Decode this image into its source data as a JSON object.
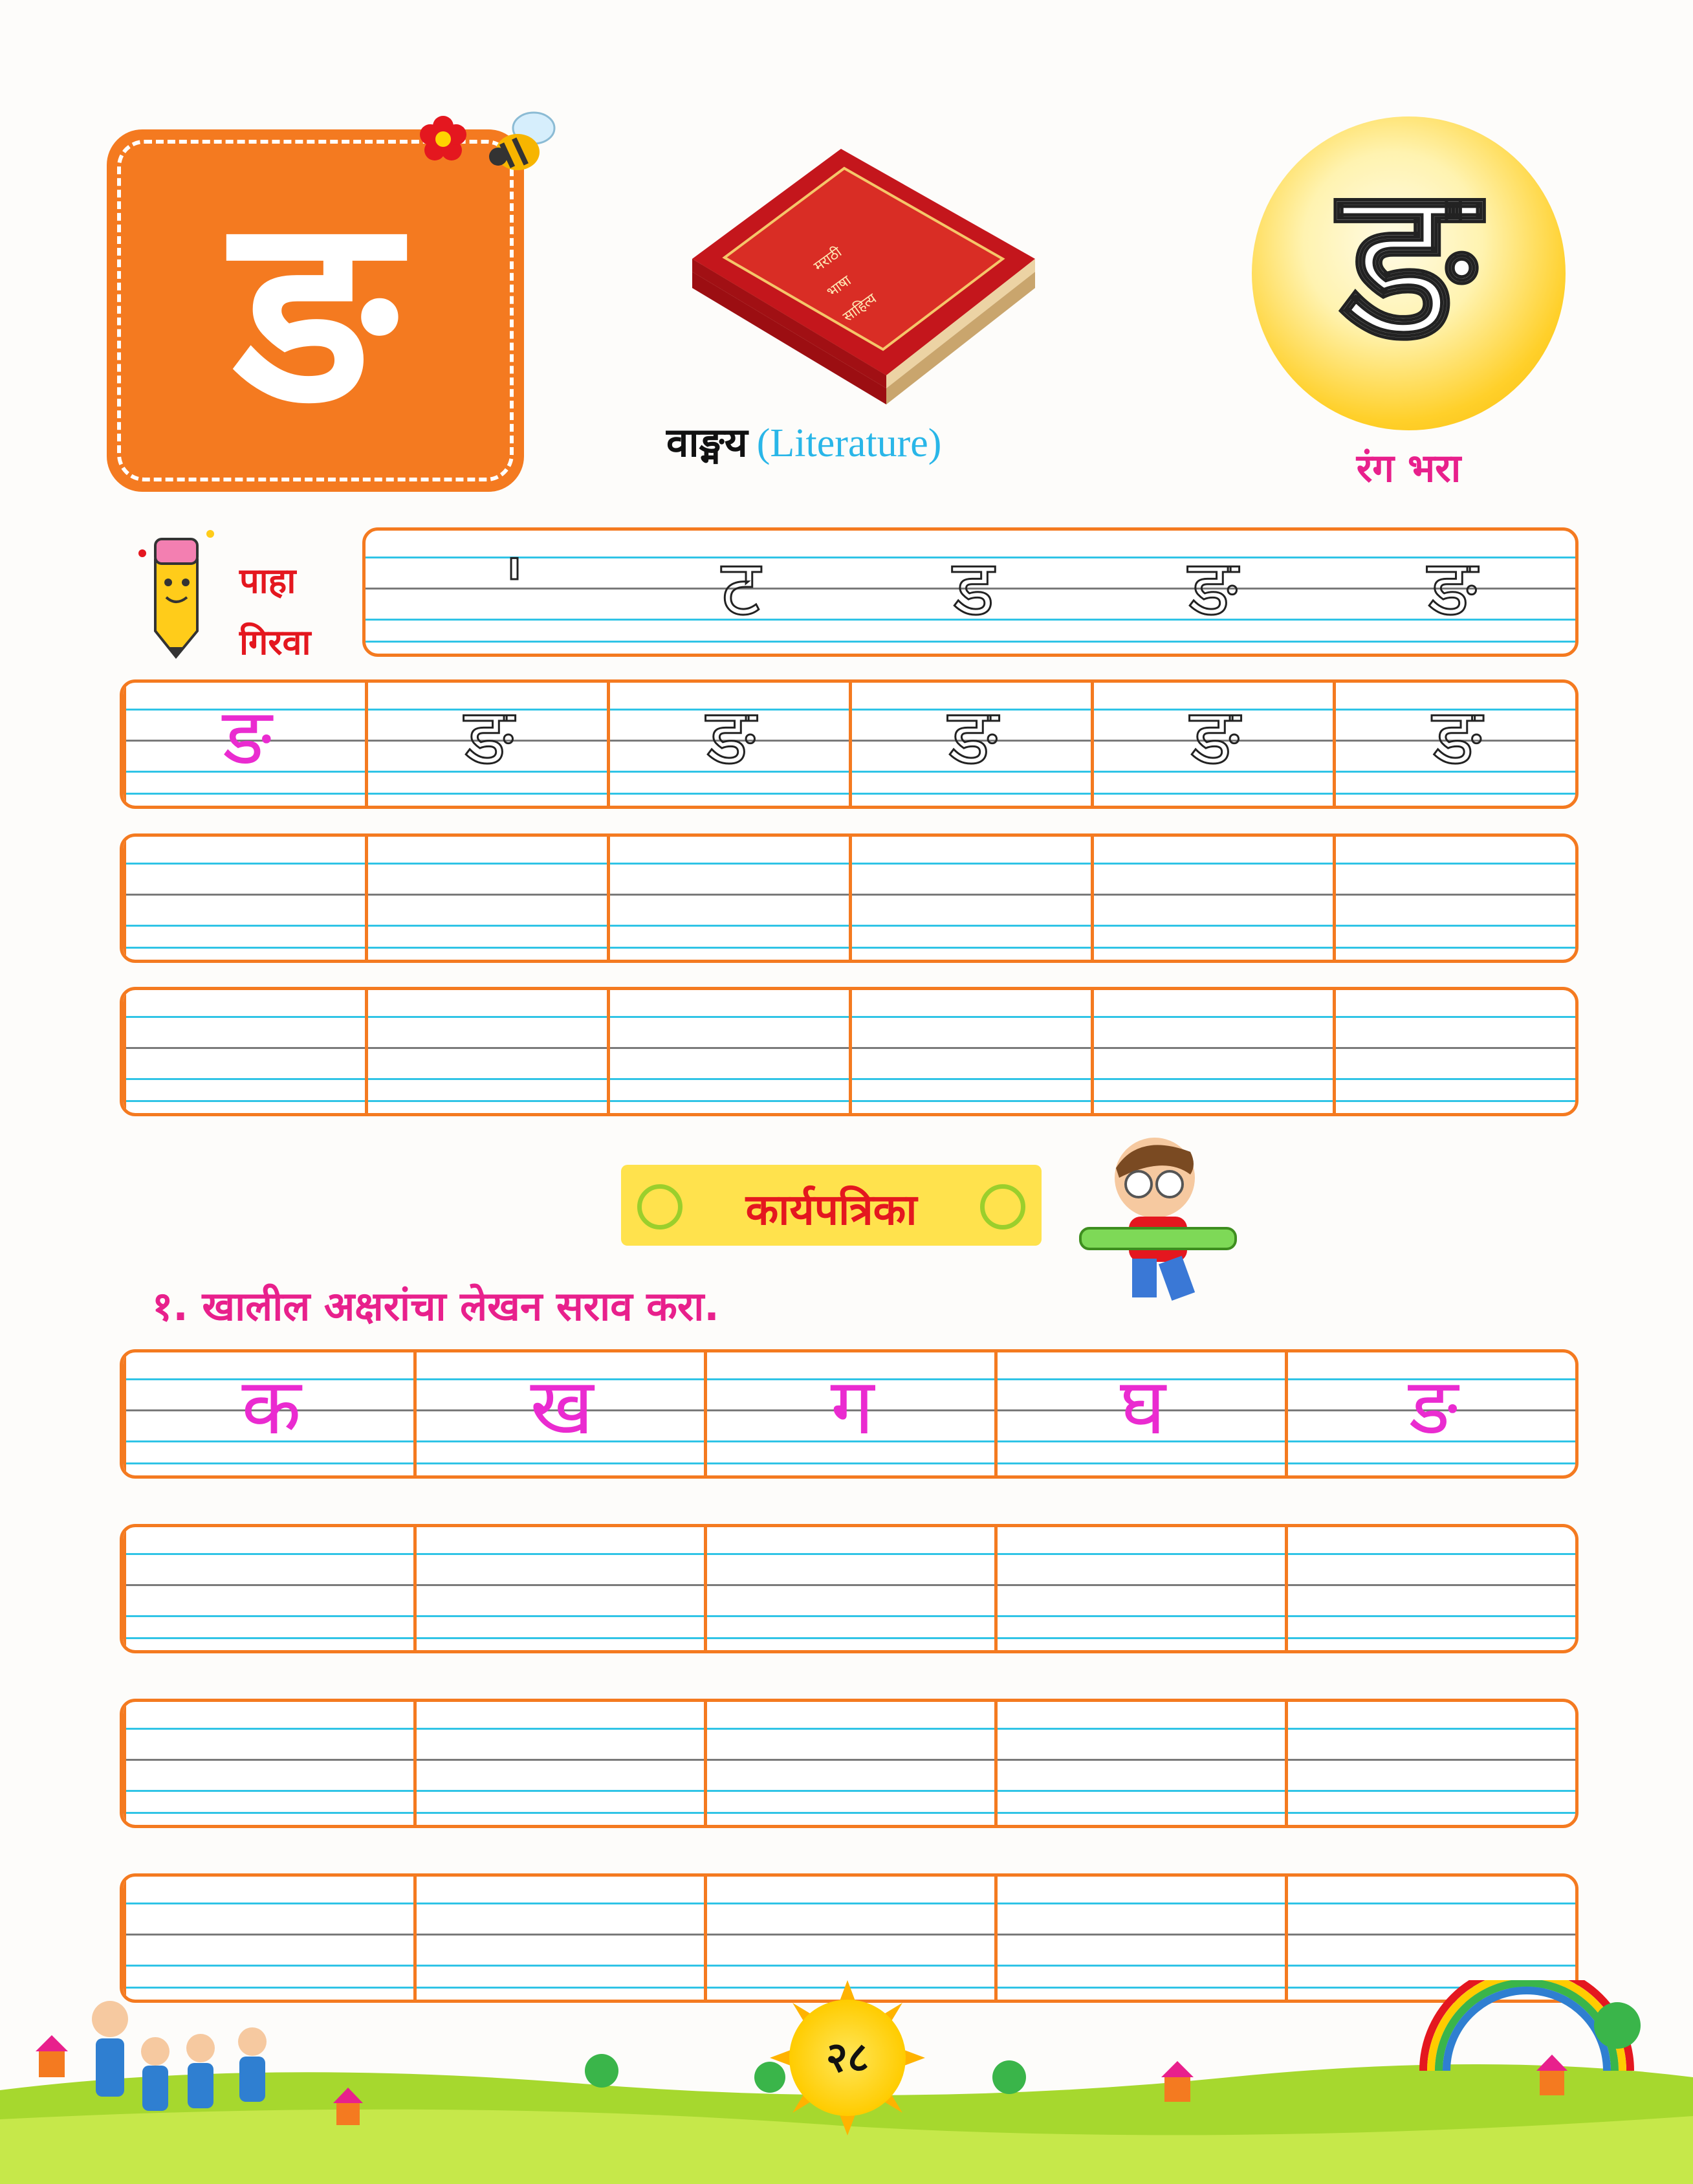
{
  "letter": "ङ",
  "word": {
    "marathi": "वाङ्मय",
    "english": "(Literature)"
  },
  "color_label": "रंग भरा",
  "see_trace": {
    "line1": "पाहा",
    "line2": "गिरवा"
  },
  "stroke_steps": [
    "'",
    "ट",
    "ड",
    "ङ",
    "ङ"
  ],
  "trace_row": [
    "ङ",
    "ङ",
    "ङ",
    "ङ",
    "ङ",
    "ङ"
  ],
  "worksheet_title": "कार्यपत्रिका",
  "instruction": "१. खालील अक्षरांचा लेखन सराव करा.",
  "practice_letters": [
    "क",
    "ख",
    "ग",
    "घ",
    "ङ"
  ],
  "page_number": "२८",
  "book_title_lines": [
    "मराठी",
    "भाषा",
    "साहित्य"
  ],
  "colors": {
    "orange": "#f47a20",
    "pink": "#e8208c",
    "red": "#e4171f",
    "cyan": "#30c4e6"
  }
}
